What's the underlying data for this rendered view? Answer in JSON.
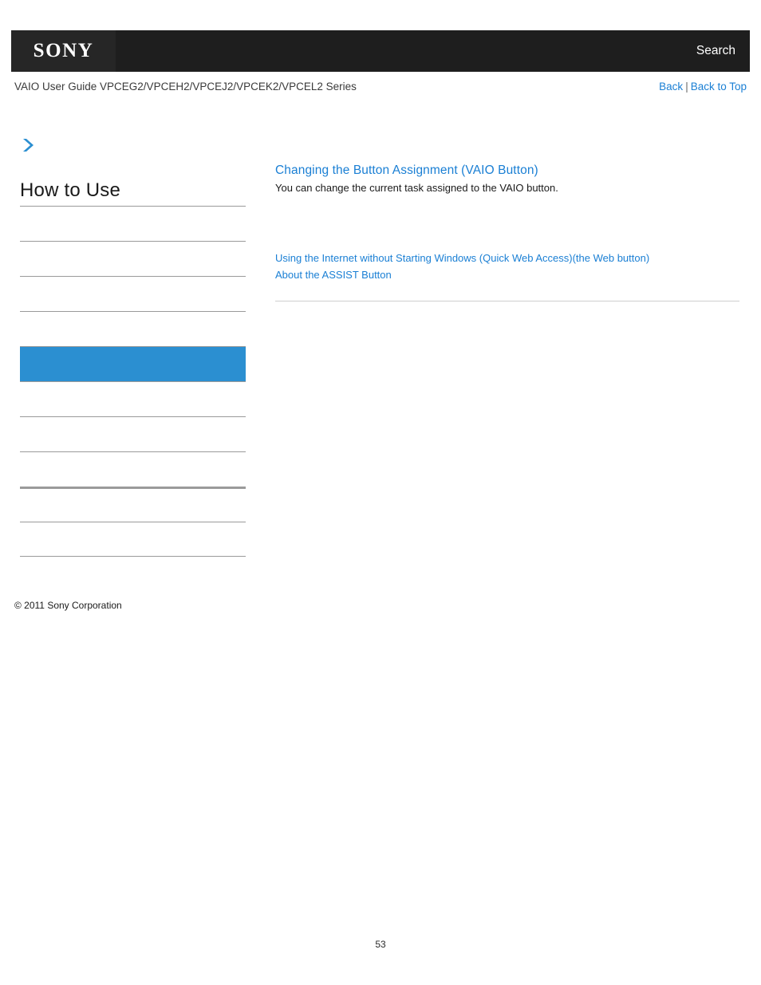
{
  "header": {
    "logo_text": "SONY",
    "search_label": "Search"
  },
  "titlebar": {
    "guide_title": "VAIO User Guide VPCEG2/VPCEH2/VPCEJ2/VPCEK2/VPCEL2 Series",
    "back_label": "Back",
    "separator": "|",
    "back_to_top_label": "Back to Top"
  },
  "sidebar": {
    "breadcrumb_icon": "chevron-right-icon",
    "heading": "How to Use",
    "items": [
      {
        "label": "",
        "active": false,
        "thick": false
      },
      {
        "label": "",
        "active": false,
        "thick": false
      },
      {
        "label": "",
        "active": false,
        "thick": false
      },
      {
        "label": "",
        "active": false,
        "thick": false
      },
      {
        "label": "",
        "active": true,
        "thick": false
      },
      {
        "label": "",
        "active": false,
        "thick": false
      },
      {
        "label": "",
        "active": false,
        "thick": false
      },
      {
        "label": "",
        "active": false,
        "thick": false
      },
      {
        "label": "",
        "active": false,
        "thick": true
      },
      {
        "label": "",
        "active": false,
        "thick": false
      }
    ],
    "active_color": "#2b8fd1",
    "copyright": "© 2011 Sony Corporation"
  },
  "main": {
    "title": "Changing the Button Assignment (VAIO Button)",
    "description": "You can change the current task assigned to the VAIO button.",
    "links": [
      "Using the Internet without Starting Windows (Quick Web Access)(the Web button)",
      "About the ASSIST Button"
    ]
  },
  "footer": {
    "page_number": "53"
  },
  "colors": {
    "header_bg": "#1e1e1e",
    "logo_bg": "#262626",
    "link": "#1a7fd4",
    "highlight": "#2b8fd1",
    "rule": "#9a9a9a"
  }
}
